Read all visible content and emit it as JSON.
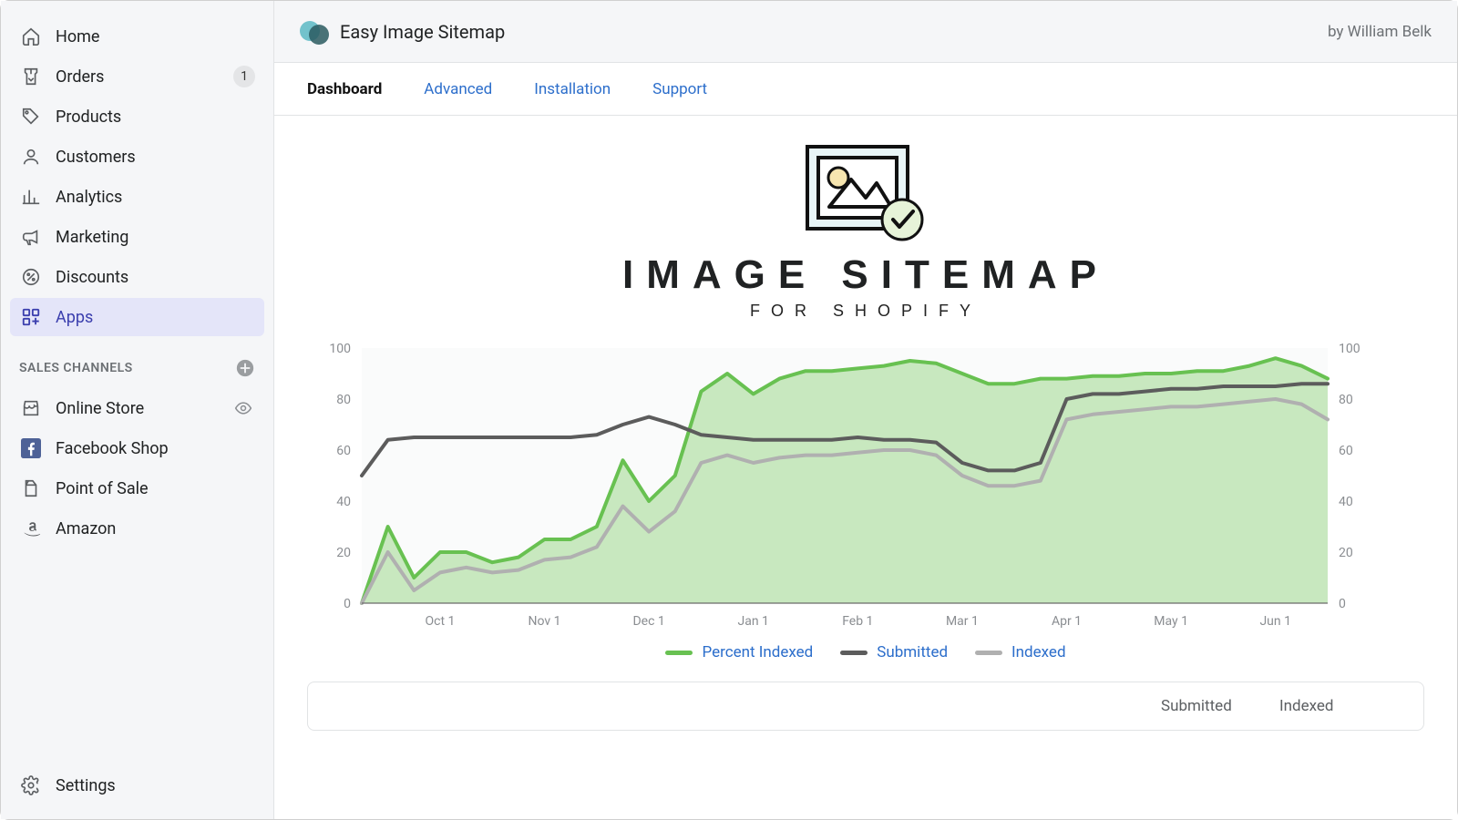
{
  "sidebar": {
    "items": [
      {
        "label": "Home",
        "icon": "home-icon"
      },
      {
        "label": "Orders",
        "icon": "orders-icon",
        "badge": "1"
      },
      {
        "label": "Products",
        "icon": "products-icon"
      },
      {
        "label": "Customers",
        "icon": "customers-icon"
      },
      {
        "label": "Analytics",
        "icon": "analytics-icon"
      },
      {
        "label": "Marketing",
        "icon": "marketing-icon"
      },
      {
        "label": "Discounts",
        "icon": "discounts-icon"
      },
      {
        "label": "Apps",
        "icon": "apps-icon",
        "active": true
      }
    ],
    "channels_heading": "SALES CHANNELS",
    "channels": [
      {
        "label": "Online Store",
        "icon": "store-icon",
        "trailing": "eye-icon"
      },
      {
        "label": "Facebook Shop",
        "icon": "facebook-icon"
      },
      {
        "label": "Point of Sale",
        "icon": "pos-icon"
      },
      {
        "label": "Amazon",
        "icon": "amazon-icon"
      }
    ],
    "footer": {
      "label": "Settings",
      "icon": "gear-icon"
    }
  },
  "header": {
    "app_title": "Easy Image Sitemap",
    "byline": "by William Belk"
  },
  "tabs": [
    {
      "label": "Dashboard",
      "active": true
    },
    {
      "label": "Advanced"
    },
    {
      "label": "Installation"
    },
    {
      "label": "Support"
    }
  ],
  "hero": {
    "title": "IMAGE SITEMAP",
    "subtitle": "FOR SHOPIFY"
  },
  "legend": {
    "percent_indexed": "Percent Indexed",
    "submitted": "Submitted",
    "indexed": "Indexed"
  },
  "colors": {
    "percent_indexed": "#68c151",
    "percent_indexed_fill": "#c2e5b8",
    "submitted": "#5c5c5c",
    "indexed": "#b0b0b0"
  },
  "table": {
    "col1": "Submitted",
    "col2": "Indexed"
  },
  "chart_data": {
    "type": "area",
    "title": "",
    "xlabel": "",
    "x_ticks": [
      "Oct 1",
      "Nov 1",
      "Dec 1",
      "Jan 1",
      "Feb 1",
      "Mar 1",
      "Apr 1",
      "May 1",
      "Jun 1"
    ],
    "left_axis": {
      "label": "",
      "range": [
        0,
        100
      ],
      "ticks": [
        0,
        20,
        40,
        60,
        80,
        100
      ]
    },
    "right_axis": {
      "label": "",
      "ticks": [
        0,
        20,
        40,
        60,
        80,
        100
      ]
    },
    "x": [
      "Sep 10",
      "Sep 17",
      "Sep 24",
      "Oct 1",
      "Oct 8",
      "Oct 15",
      "Oct 22",
      "Nov 1",
      "Nov 8",
      "Nov 15",
      "Nov 22",
      "Dec 1",
      "Dec 8",
      "Dec 15",
      "Dec 22",
      "Jan 1",
      "Jan 8",
      "Jan 15",
      "Jan 22",
      "Feb 1",
      "Feb 8",
      "Feb 15",
      "Feb 22",
      "Mar 1",
      "Mar 8",
      "Mar 15",
      "Mar 22",
      "Apr 1",
      "Apr 8",
      "Apr 15",
      "Apr 22",
      "May 1",
      "May 8",
      "May 15",
      "May 22",
      "Jun 1",
      "Jun 8",
      "Jun 15"
    ],
    "series": [
      {
        "name": "Percent Indexed",
        "axis": "left",
        "color": "#68c151",
        "fill": "#c2e5b8",
        "values": [
          0,
          30,
          10,
          20,
          20,
          16,
          18,
          25,
          25,
          30,
          56,
          40,
          50,
          83,
          90,
          82,
          88,
          91,
          91,
          92,
          93,
          95,
          94,
          90,
          86,
          86,
          88,
          88,
          89,
          89,
          90,
          90,
          91,
          91,
          93,
          96,
          93,
          88
        ]
      },
      {
        "name": "Submitted",
        "axis": "right",
        "color": "#5c5c5c",
        "values": [
          50,
          64,
          65,
          65,
          65,
          65,
          65,
          65,
          65,
          66,
          70,
          73,
          70,
          66,
          65,
          64,
          64,
          64,
          64,
          65,
          64,
          64,
          63,
          55,
          52,
          52,
          55,
          80,
          82,
          82,
          83,
          84,
          84,
          85,
          85,
          85,
          86,
          86
        ]
      },
      {
        "name": "Indexed",
        "axis": "right",
        "color": "#b0b0b0",
        "values": [
          0,
          20,
          5,
          12,
          14,
          12,
          13,
          17,
          18,
          22,
          38,
          28,
          36,
          55,
          58,
          55,
          57,
          58,
          58,
          59,
          60,
          60,
          58,
          50,
          46,
          46,
          48,
          72,
          74,
          75,
          76,
          77,
          77,
          78,
          79,
          80,
          78,
          72
        ]
      }
    ]
  }
}
